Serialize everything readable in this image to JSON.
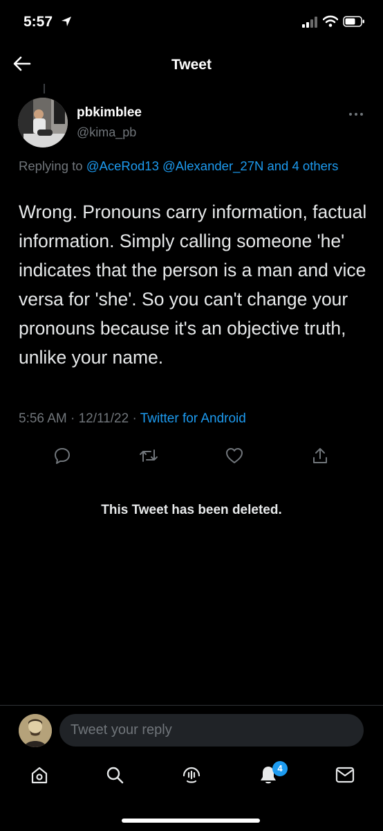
{
  "status_bar": {
    "time": "5:57",
    "location_icon": "location-arrow-icon",
    "signal_icon": "cellular-signal-icon",
    "wifi_icon": "wifi-icon",
    "battery_icon": "battery-icon"
  },
  "header": {
    "title": "Tweet",
    "back_icon": "arrow-left-icon"
  },
  "tweet": {
    "display_name": "pbkimblee",
    "handle": "@kima_pb",
    "more_icon": "more-horizontal-icon",
    "replying_prefix": "Replying to",
    "mentions": [
      "@AceRod13",
      "@Alexander_27N"
    ],
    "mentions_suffix": "and 4 others",
    "text": "Wrong. Pronouns carry information, factual information. Simply calling someone 'he' indicates that the person is a man and vice versa for 'she'. So you can't change your pronouns because it's an objective truth, unlike your name.",
    "time": "5:56 AM",
    "separator": "·",
    "date": "12/11/22",
    "source": "Twitter for Android",
    "actions": [
      "reply-icon",
      "retweet-icon",
      "like-icon",
      "share-icon"
    ]
  },
  "deleted_notice": "This Tweet has been deleted.",
  "reply_bar": {
    "placeholder": "Tweet your reply"
  },
  "tab_bar": {
    "tabs": [
      "home-icon",
      "search-icon",
      "spaces-icon",
      "notifications-icon",
      "messages-icon"
    ],
    "notification_count": "4"
  },
  "colors": {
    "background": "#000000",
    "text": "#e7e9ea",
    "secondary_text": "#71767b",
    "accent": "#1d9bf0"
  }
}
